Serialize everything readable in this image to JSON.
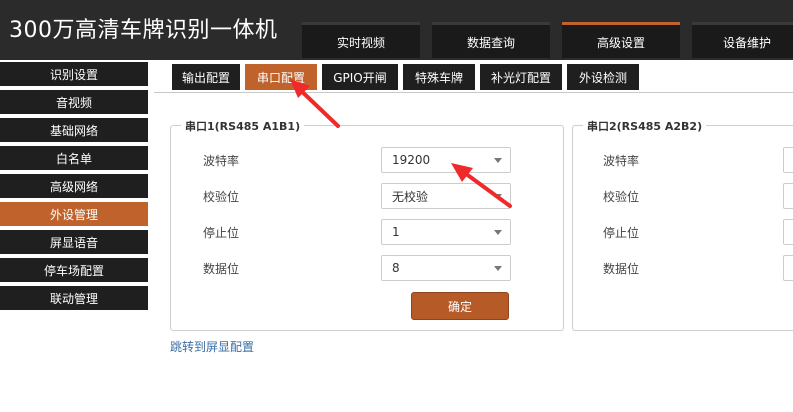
{
  "header": {
    "title": "300万高清车牌识别一体机",
    "tabs": [
      {
        "label": "实时视频"
      },
      {
        "label": "数据查询"
      },
      {
        "label": "高级设置"
      },
      {
        "label": "设备维护"
      }
    ]
  },
  "sidebar": {
    "items": [
      {
        "label": "识别设置"
      },
      {
        "label": "音视频"
      },
      {
        "label": "基础网络"
      },
      {
        "label": "白名单"
      },
      {
        "label": "高级网络"
      },
      {
        "label": "外设管理"
      },
      {
        "label": "屏显语音"
      },
      {
        "label": "停车场配置"
      },
      {
        "label": "联动管理"
      }
    ]
  },
  "subtabs": [
    {
      "label": "输出配置"
    },
    {
      "label": "串口配置"
    },
    {
      "label": "GPIO开闸"
    },
    {
      "label": "特殊车牌"
    },
    {
      "label": "补光灯配置"
    },
    {
      "label": "外设检测"
    }
  ],
  "serial1": {
    "legend": "串口1(RS485 A1B1)",
    "baud_label": "波特率",
    "baud_value": "19200",
    "parity_label": "校验位",
    "parity_value": "无校验",
    "stop_label": "停止位",
    "stop_value": "1",
    "data_label": "数据位",
    "data_value": "8",
    "confirm_label": "确定"
  },
  "serial2": {
    "legend": "串口2(RS485 A2B2)",
    "baud_label": "波特率",
    "parity_label": "校验位",
    "stop_label": "停止位",
    "data_label": "数据位"
  },
  "link_label": "跳转到屏显配置",
  "colors": {
    "accent": "#c0622b",
    "dark": "#1f1f1f",
    "arrow": "#ee2a2a"
  }
}
